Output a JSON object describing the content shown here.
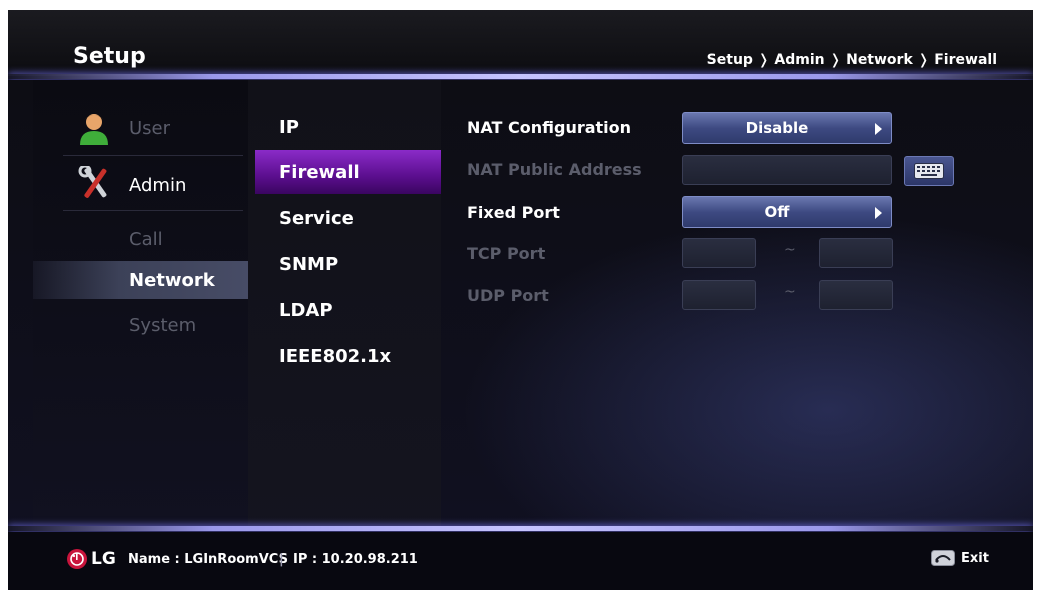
{
  "header": {
    "title": "Setup",
    "breadcrumb": "Setup ❭ Admin ❭ Network ❭ Firewall"
  },
  "primary_menu": {
    "items": [
      {
        "label": "User",
        "icon": "user-icon",
        "state": "dimmed"
      },
      {
        "label": "Admin",
        "icon": "tools-icon",
        "state": "active"
      },
      {
        "label": "Call",
        "state": "dimmed"
      },
      {
        "label": "Network",
        "state": "selected"
      },
      {
        "label": "System",
        "state": "dimmed"
      }
    ]
  },
  "network_menu": {
    "items": [
      {
        "label": "IP"
      },
      {
        "label": "Firewall",
        "selected": true
      },
      {
        "label": "Service"
      },
      {
        "label": "SNMP"
      },
      {
        "label": "LDAP"
      },
      {
        "label": "IEEE802.1x"
      }
    ]
  },
  "settings": {
    "nat_configuration": {
      "label": "NAT Configuration",
      "value": "Disable"
    },
    "nat_public_address": {
      "label": "NAT Public Address",
      "value": ""
    },
    "fixed_port": {
      "label": "Fixed Port",
      "value": "Off"
    },
    "tcp_port": {
      "label": "TCP Port",
      "separator": "~"
    },
    "udp_port": {
      "label": "UDP Port",
      "separator": "~"
    }
  },
  "footer": {
    "brand": "LG",
    "name_text": "Name : LGInRoomVCS",
    "divider": "|",
    "ip_text": "IP : 10.20.98.211",
    "exit_label": "Exit"
  },
  "colors": {
    "selected_submenu": "#7a1fb8",
    "selected_menu": "#474c66",
    "select_box": "#4a5790",
    "disabled_text": "#5b5d6b",
    "accent_line": "#b9b7ff"
  }
}
